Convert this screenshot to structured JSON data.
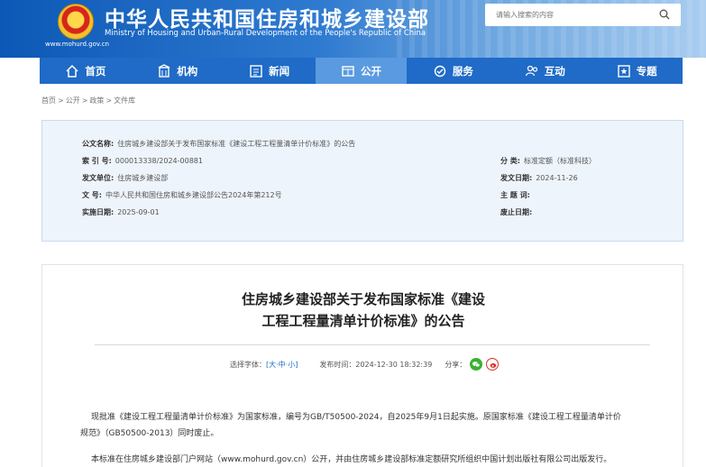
{
  "header": {
    "title": "中华人民共和国住房和城乡建设部",
    "subtitle": "Ministry of Housing and Urban-Rural Development of the People's Republic of China",
    "url": "www.mohurd.gov.cn",
    "search_placeholder": "请输入搜索的内容",
    "colors": {
      "banner": "#0c58b6",
      "nav": "#1f6bc7",
      "nav_active": "#5a9ae0"
    }
  },
  "nav": {
    "items": [
      {
        "label": "首页",
        "icon": "home-icon"
      },
      {
        "label": "机构",
        "icon": "building-icon"
      },
      {
        "label": "新闻",
        "icon": "news-icon"
      },
      {
        "label": "公开",
        "icon": "disclosure-icon",
        "active": true
      },
      {
        "label": "服务",
        "icon": "service-icon"
      },
      {
        "label": "互动",
        "icon": "interact-icon"
      },
      {
        "label": "专题",
        "icon": "topic-icon"
      }
    ]
  },
  "breadcrumb": [
    "首页",
    "公开",
    "政策",
    "文件库"
  ],
  "breadcrumb_sep": ">",
  "meta": {
    "title_key": "公文名称:",
    "title_val": "住房城乡建设部关于发布国家标准《建设工程工程量清单计价标准》的公告",
    "index_key": "索 引 号:",
    "index_val": "000013338/2024-00881",
    "category_key": "分      类:",
    "category_val": "标准定额（标准科技）",
    "issuer_key": "发文单位:",
    "issuer_val": "住房城乡建设部",
    "date_key": "发文日期:",
    "date_val": "2024-11-26",
    "docno_key": "文      号:",
    "docno_val": "中华人民共和国住房和城乡建设部公告2024年第212号",
    "subject_key": "主 题 词:",
    "subject_val": "",
    "effective_key": "实施日期:",
    "effective_val": "2025-09-01",
    "expire_key": "废止日期:",
    "expire_val": ""
  },
  "article": {
    "title_line1": "住房城乡建设部关于发布国家标准《建设",
    "title_line2": "工程工程量清单计价标准》的公告",
    "font_label": "选择字体：",
    "font_open": "[",
    "font_large": "大",
    "font_dot1": "·",
    "font_medium": "中",
    "font_dot2": "·",
    "font_small": "小",
    "font_close": "]",
    "publish_label": "发布时间：",
    "publish_time": "2024-12-30 18:32:39",
    "share_label": "分享：",
    "para1_line1": "现批准《建设工程工程量清单计价标准》为国家标准，编号为GB/T50500-2024，自2025年9月1日起实施。原国家标准《建设工程工程量清单计价",
    "para1_line2": "规范》（GB50500-2013）同时废止。",
    "para2": "本标准在住房城乡建设部门户网站（www.mohurd.gov.cn）公开，并由住房城乡建设部标准定额研究所组织中国计划出版社有限公司出版发行。"
  }
}
